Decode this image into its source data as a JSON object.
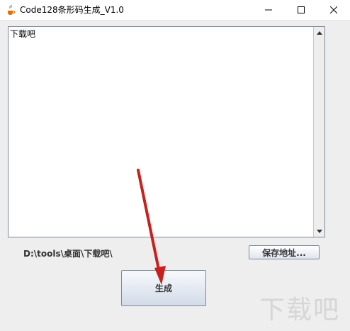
{
  "window": {
    "title": "Code128条形码生成_V1.0",
    "icon": "java-coffee-icon"
  },
  "textarea": {
    "value": "下载吧"
  },
  "path_label": "D:\\tools\\桌面\\下载吧\\",
  "buttons": {
    "save_address": "保存地址...",
    "generate": "生成"
  },
  "watermark": {
    "text": "下载吧"
  },
  "colors": {
    "arrow": "#c8201c",
    "button_border": "#7a8a99"
  }
}
